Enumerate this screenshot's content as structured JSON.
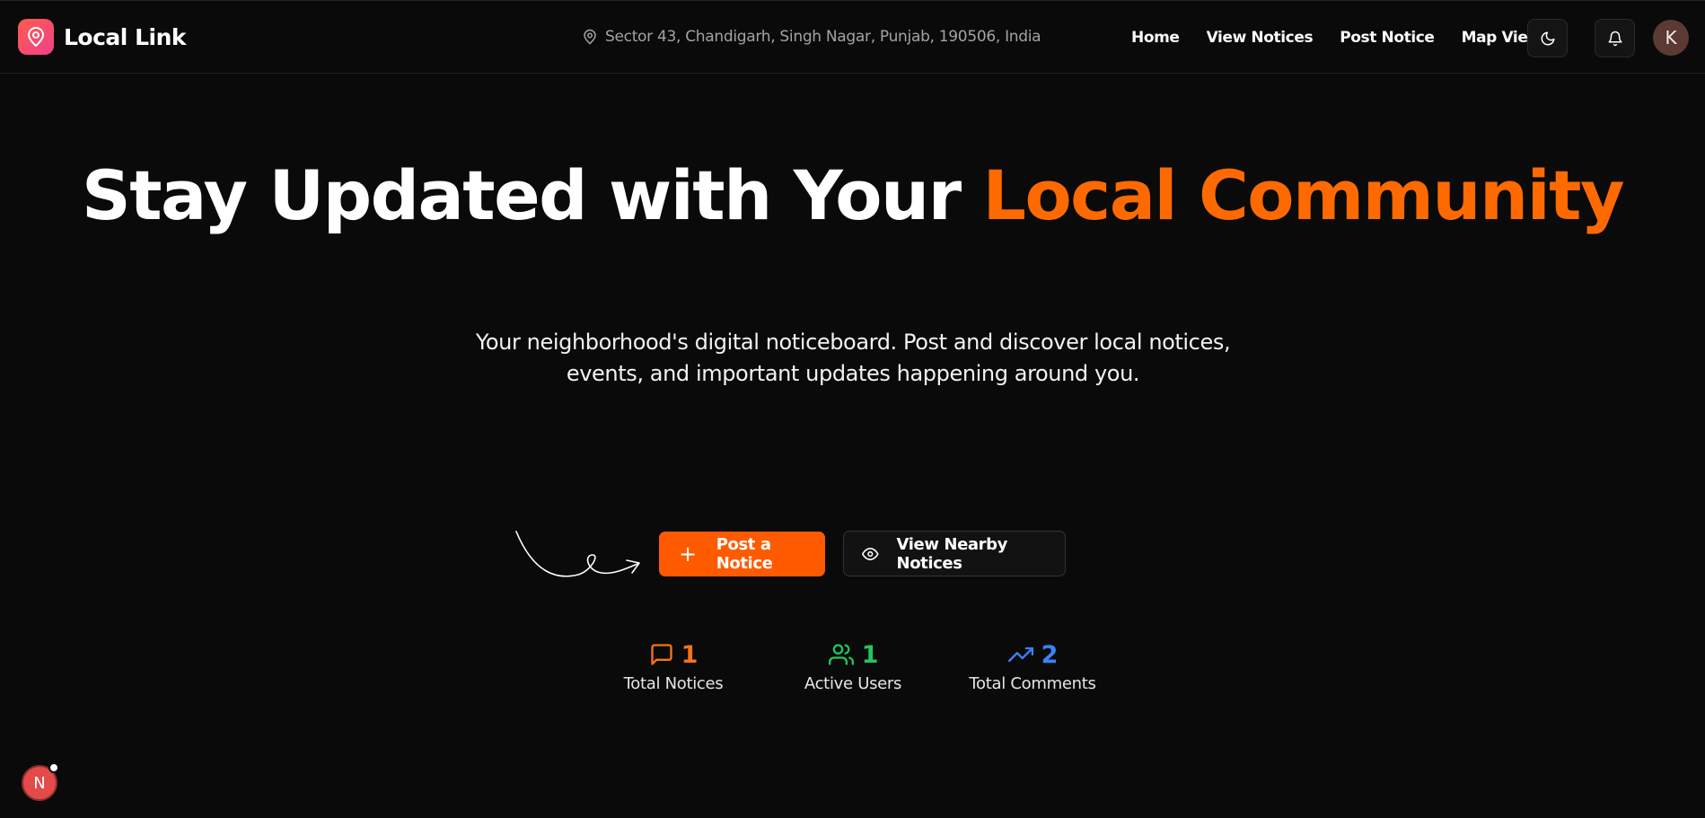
{
  "app": {
    "name": "Local Link"
  },
  "header": {
    "location": "Sector 43, Chandigarh, Singh Nagar, Punjab, 190506, India",
    "nav": [
      "Home",
      "View Notices",
      "Post Notice",
      "Map View"
    ],
    "avatar_initial": "K"
  },
  "hero": {
    "title_main": "Stay Updated with Your ",
    "title_accent": "Local Community",
    "subtitle_line1": "Your neighborhood's digital noticeboard. Post and discover local notices,",
    "subtitle_line2": "events, and important updates happening around you."
  },
  "actions": {
    "primary": "Post a Notice",
    "secondary": "View Nearby Notices"
  },
  "stats": [
    {
      "value": "1",
      "label": "Total Notices",
      "color": "#f97316",
      "icon": "message-square-icon"
    },
    {
      "value": "1",
      "label": "Active Users",
      "color": "#22c55e",
      "icon": "users-icon"
    },
    {
      "value": "2",
      "label": "Total Comments",
      "color": "#3b82f6",
      "icon": "trending-up-icon"
    }
  ],
  "dev_badge": {
    "label": "N"
  },
  "colors": {
    "accent": "#ff6a00",
    "background": "#0a0a0a"
  }
}
